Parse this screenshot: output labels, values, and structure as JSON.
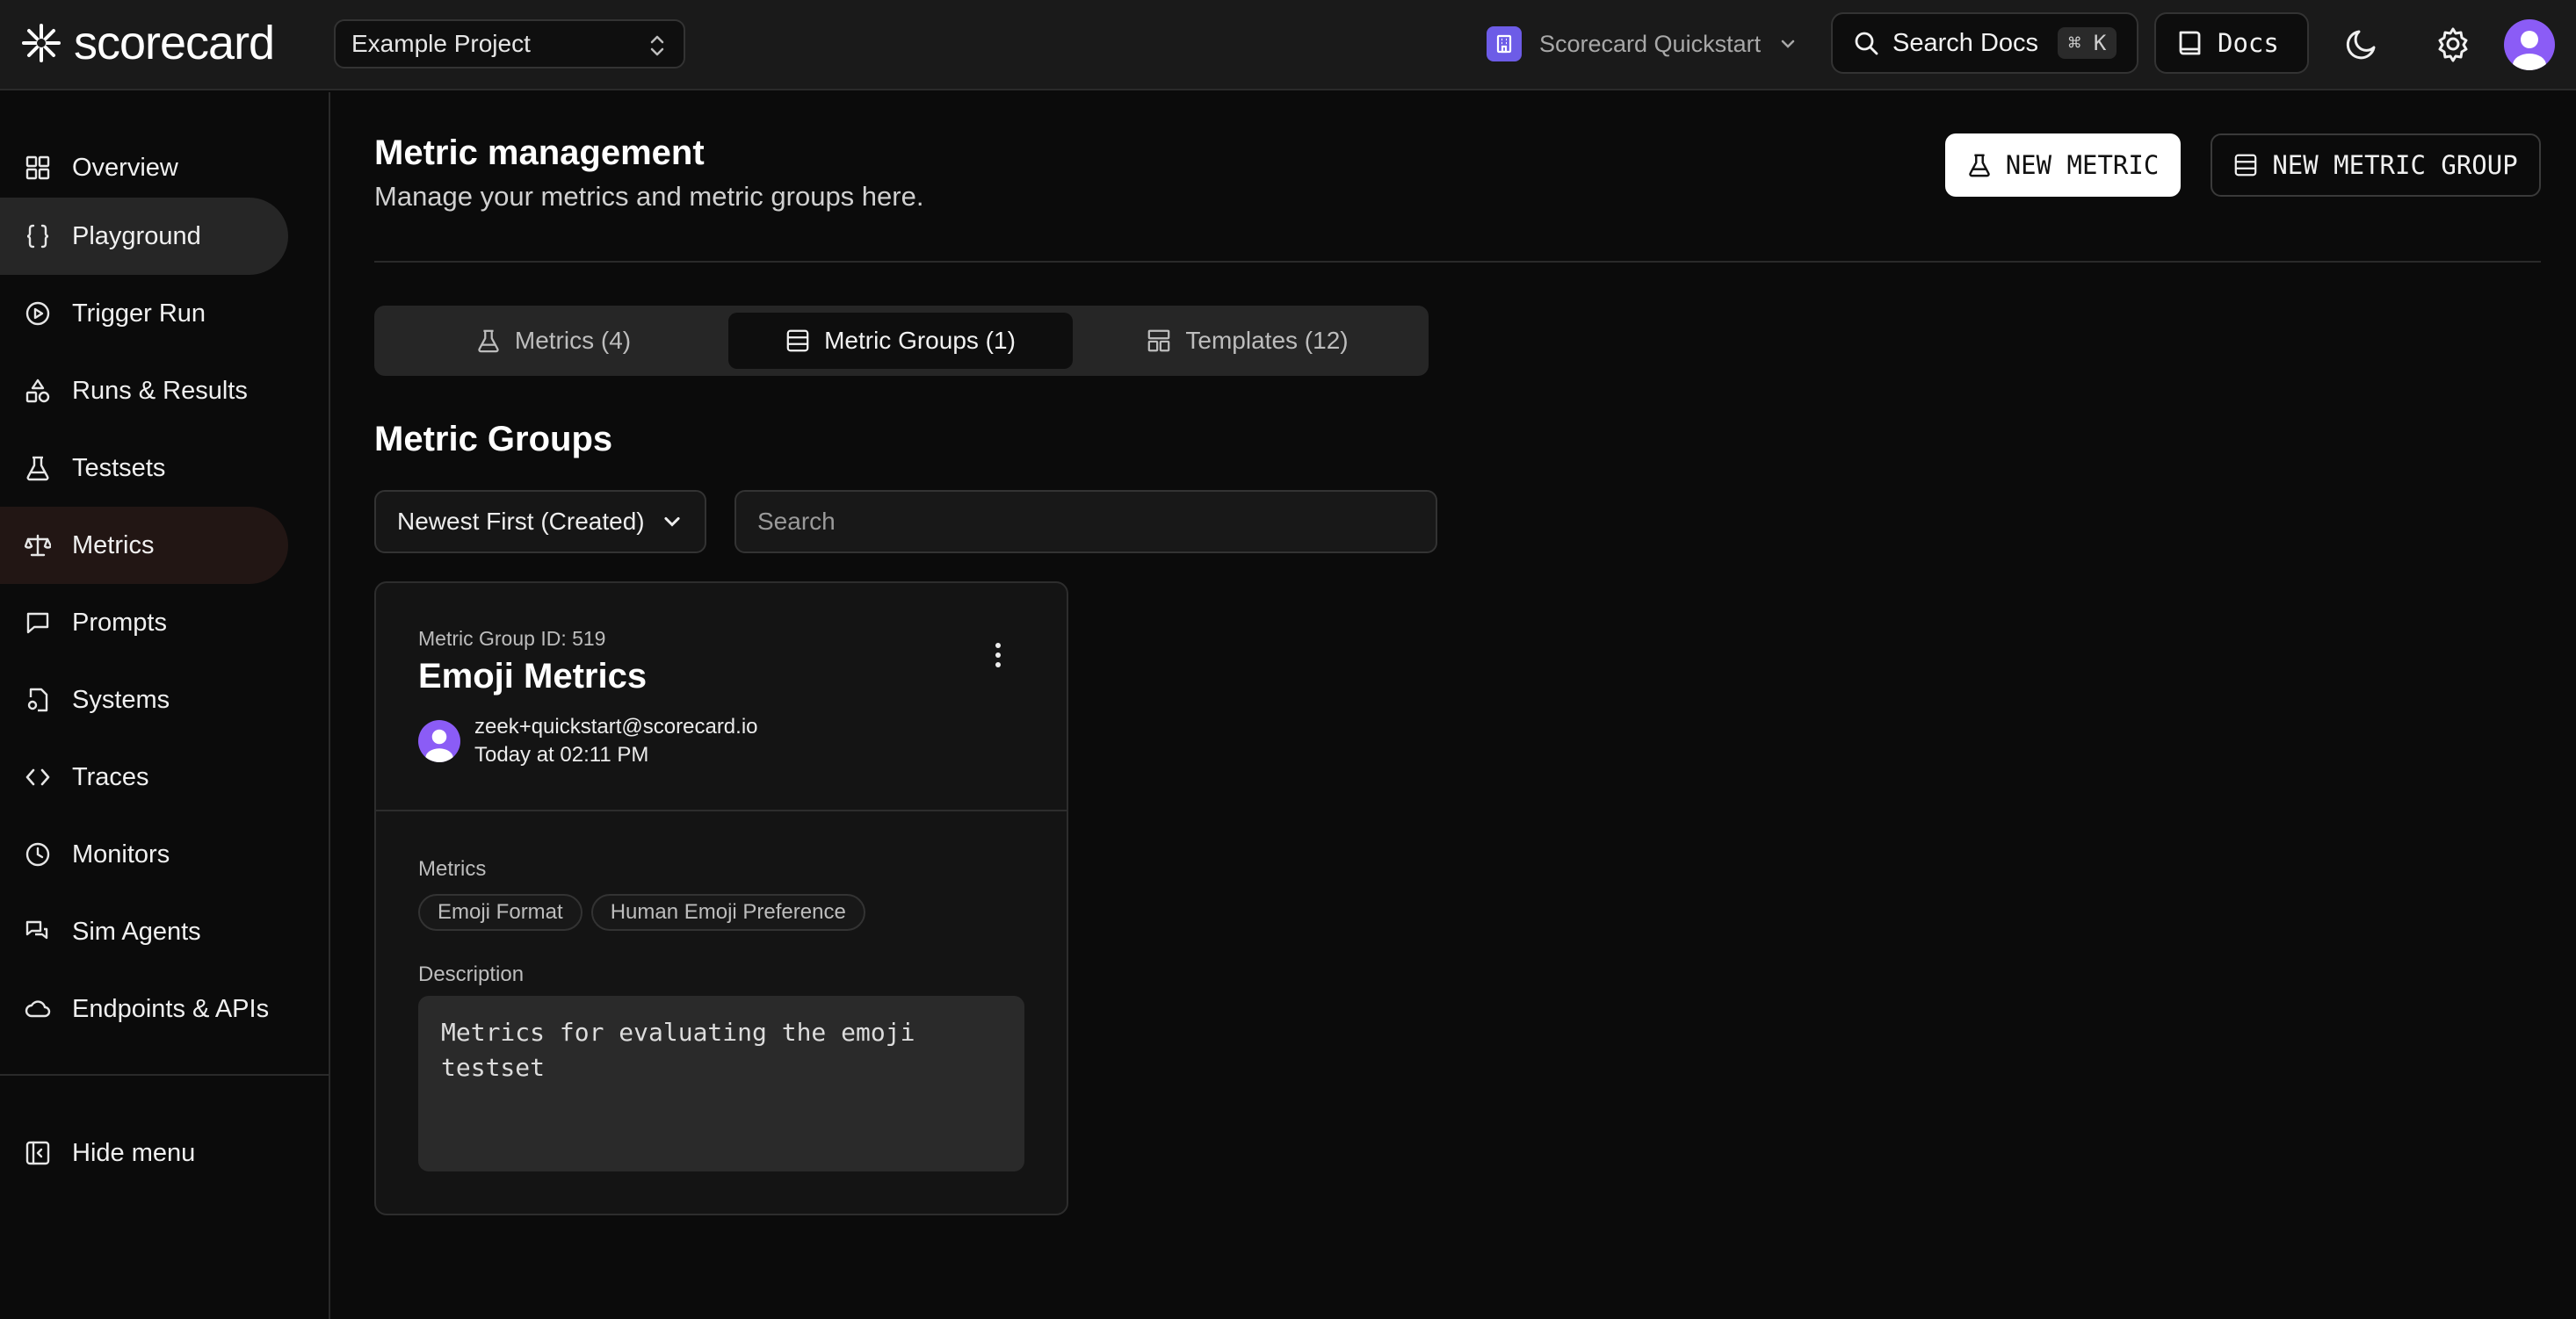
{
  "header": {
    "logo_text": "scorecard",
    "project_select": {
      "value": "Example Project"
    },
    "org": {
      "name": "Scorecard Quickstart"
    },
    "search_docs": {
      "label": "Search Docs",
      "shortcut": "⌘ K"
    },
    "docs_button": {
      "label": "Docs"
    },
    "icons": [
      "moon-icon",
      "gear-icon",
      "user-avatar"
    ]
  },
  "sidebar": {
    "items": [
      {
        "label": "Overview",
        "icon": "grid-icon"
      },
      {
        "label": "Playground",
        "icon": "braces-icon"
      },
      {
        "label": "Trigger Run",
        "icon": "play-circle-icon"
      },
      {
        "label": "Runs & Results",
        "icon": "shapes-icon"
      },
      {
        "label": "Testsets",
        "icon": "flask-icon"
      },
      {
        "label": "Metrics",
        "icon": "scale-icon"
      },
      {
        "label": "Prompts",
        "icon": "message-square-icon"
      },
      {
        "label": "Systems",
        "icon": "file-cog-icon"
      },
      {
        "label": "Traces",
        "icon": "code-icon"
      },
      {
        "label": "Monitors",
        "icon": "clock-icon"
      },
      {
        "label": "Sim Agents",
        "icon": "messages-icon"
      },
      {
        "label": "Endpoints & APIs",
        "icon": "cloud-icon"
      }
    ],
    "hide_menu": {
      "label": "Hide menu",
      "icon": "panel-left-icon"
    }
  },
  "main": {
    "title": "Metric management",
    "subtitle": "Manage your metrics and metric groups here.",
    "new_metric_label": "NEW METRIC",
    "new_metric_group_label": "NEW METRIC GROUP",
    "tabs": [
      {
        "label": "Metrics (4)",
        "icon": "flask-icon",
        "active": false
      },
      {
        "label": "Metric Groups (1)",
        "icon": "list-icon",
        "active": true
      },
      {
        "label": "Templates (12)",
        "icon": "layout-icon",
        "active": false
      }
    ],
    "section_title": "Metric Groups",
    "sort": {
      "value": "Newest First (Created)"
    },
    "search": {
      "placeholder": "Search",
      "value": ""
    },
    "card": {
      "id_label": "Metric Group ID: 519",
      "title": "Emoji Metrics",
      "email": "zeek+quickstart@scorecard.io",
      "time": "Today at 02:11 PM",
      "metrics_label": "Metrics",
      "metrics": [
        "Emoji Format",
        "Human Emoji Preference"
      ],
      "description_label": "Description",
      "description": "Metrics for evaluating the emoji testset"
    }
  },
  "colors": {
    "accent_purple": "#8b5cf6",
    "org_icon": "#6d5ce7",
    "active_metrics_bg": "#221614",
    "active_playground_bg": "#262626"
  }
}
